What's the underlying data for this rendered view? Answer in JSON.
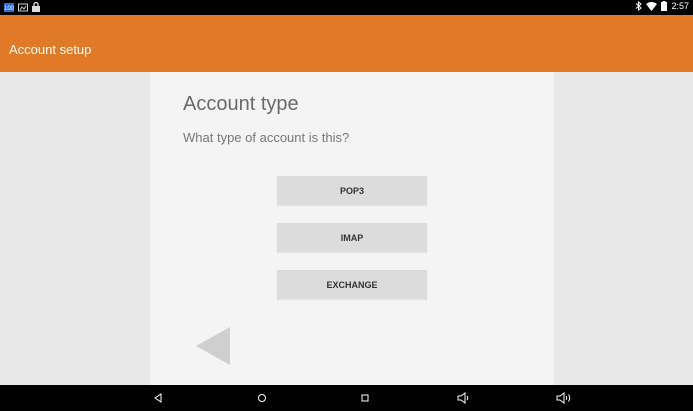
{
  "status_bar": {
    "time": "2:57",
    "left_icons": [
      "notification-100-icon",
      "image-icon",
      "lock-icon"
    ],
    "right_icons": [
      "bluetooth-icon",
      "wifi-icon",
      "battery-icon"
    ]
  },
  "app_bar": {
    "title": "Account setup",
    "color": "#e07a26"
  },
  "main": {
    "heading": "Account type",
    "question": "What type of account is this?",
    "options": [
      {
        "label": "POP3"
      },
      {
        "label": "IMAP"
      },
      {
        "label": "EXCHANGE"
      }
    ],
    "back_icon": "back-arrow-icon"
  },
  "nav_bar": {
    "icons": [
      "nav-back-icon",
      "nav-home-icon",
      "nav-recents-icon",
      "volume-down-icon",
      "volume-up-icon"
    ]
  }
}
